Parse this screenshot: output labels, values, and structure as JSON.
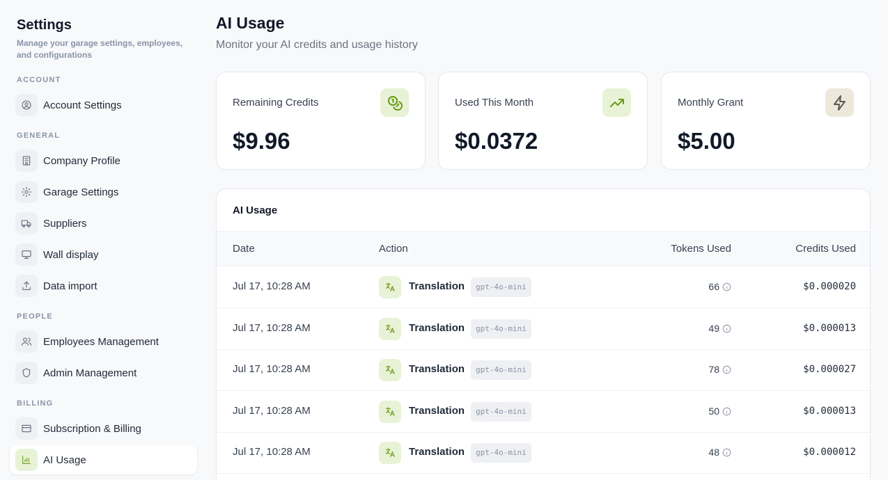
{
  "sidebar": {
    "title": "Settings",
    "subtitle": "Manage your garage settings, employees, and configurations",
    "sections": {
      "account": "ACCOUNT",
      "general": "GENERAL",
      "people": "PEOPLE",
      "billing": "BILLING"
    },
    "items": [
      {
        "label": "Account Settings",
        "icon": "user-circle-icon"
      },
      {
        "label": "Company Profile",
        "icon": "building-icon"
      },
      {
        "label": "Garage Settings",
        "icon": "gear-icon"
      },
      {
        "label": "Suppliers",
        "icon": "truck-icon"
      },
      {
        "label": "Wall display",
        "icon": "monitor-icon"
      },
      {
        "label": "Data import",
        "icon": "upload-icon"
      },
      {
        "label": "Employees Management",
        "icon": "users-icon"
      },
      {
        "label": "Admin Management",
        "icon": "shield-icon"
      },
      {
        "label": "Subscription & Billing",
        "icon": "credit-card-icon"
      },
      {
        "label": "AI Usage",
        "icon": "bar-chart-icon",
        "active": true
      }
    ]
  },
  "header": {
    "title": "AI Usage",
    "subtitle": "Monitor your AI credits and usage history"
  },
  "cards": [
    {
      "label": "Remaining Credits",
      "value": "$9.96",
      "icon": "coins-icon"
    },
    {
      "label": "Used This Month",
      "value": "$0.0372",
      "icon": "trending-up-icon"
    },
    {
      "label": "Monthly Grant",
      "value": "$5.00",
      "icon": "zap-icon"
    }
  ],
  "usage_table": {
    "title": "AI Usage",
    "columns": [
      "Date",
      "Action",
      "Tokens Used",
      "Credits Used"
    ],
    "rows": [
      {
        "date": "Jul 17, 10:28 AM",
        "action": "Translation",
        "model": "gpt-4o-mini",
        "tokens": "66",
        "credits": "$0.000020"
      },
      {
        "date": "Jul 17, 10:28 AM",
        "action": "Translation",
        "model": "gpt-4o-mini",
        "tokens": "49",
        "credits": "$0.000013"
      },
      {
        "date": "Jul 17, 10:28 AM",
        "action": "Translation",
        "model": "gpt-4o-mini",
        "tokens": "78",
        "credits": "$0.000027"
      },
      {
        "date": "Jul 17, 10:28 AM",
        "action": "Translation",
        "model": "gpt-4o-mini",
        "tokens": "50",
        "credits": "$0.000013"
      },
      {
        "date": "Jul 17, 10:28 AM",
        "action": "Translation",
        "model": "gpt-4o-mini",
        "tokens": "48",
        "credits": "$0.000012"
      }
    ]
  },
  "colors": {
    "accent": "#6a9a17",
    "accent_bg": "#e8f2d6",
    "page_bg": "#f8f9fb"
  }
}
